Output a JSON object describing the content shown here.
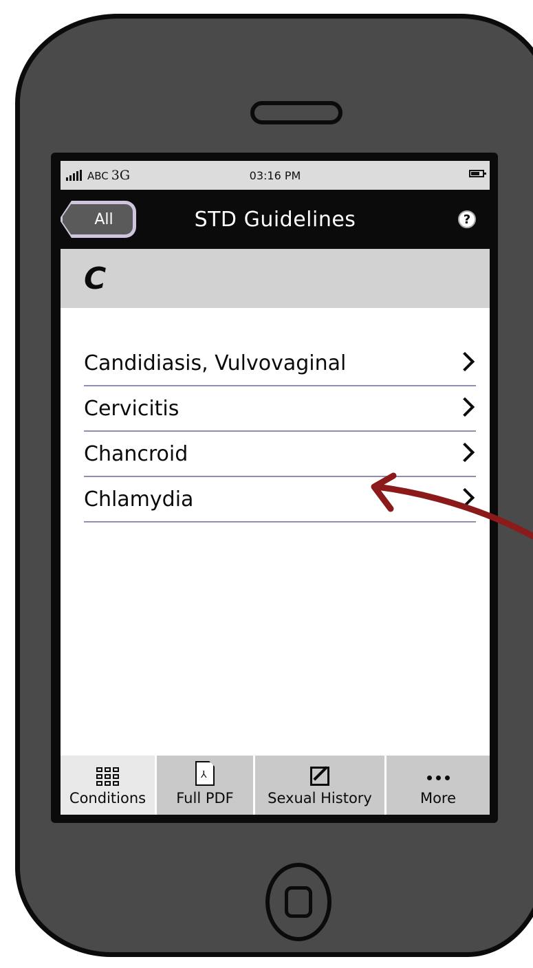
{
  "status_bar": {
    "carrier": "ABC",
    "network": "3G",
    "time": "03:16 PM",
    "signal_icon": "signal-bars-icon",
    "battery_icon": "battery-icon"
  },
  "nav_bar": {
    "back_label": "All",
    "title": "STD Guidelines",
    "help_icon": "help-icon",
    "help_glyph": "?"
  },
  "section": {
    "letter": "C"
  },
  "list": {
    "items": [
      {
        "label": "Candidiasis, Vulvovaginal"
      },
      {
        "label": "Cervicitis"
      },
      {
        "label": "Chancroid"
      },
      {
        "label": "Chlamydia"
      }
    ]
  },
  "tab_bar": {
    "tabs": [
      {
        "label": "Conditions",
        "icon": "grid-icon",
        "active": true
      },
      {
        "label": "Full PDF",
        "icon": "pdf-icon",
        "active": false
      },
      {
        "label": "Sexual History",
        "icon": "edit-icon",
        "active": false
      },
      {
        "label": "More",
        "icon": "more-icon",
        "active": false
      }
    ]
  },
  "colors": {
    "phone_body": "#4a4a4a",
    "outline": "#0b0b0b",
    "nav_bar": "#0b0b0b",
    "section_header": "#d2d2d2",
    "divider": "#8c90ad",
    "annotation_arrow": "#8b1a1a"
  }
}
